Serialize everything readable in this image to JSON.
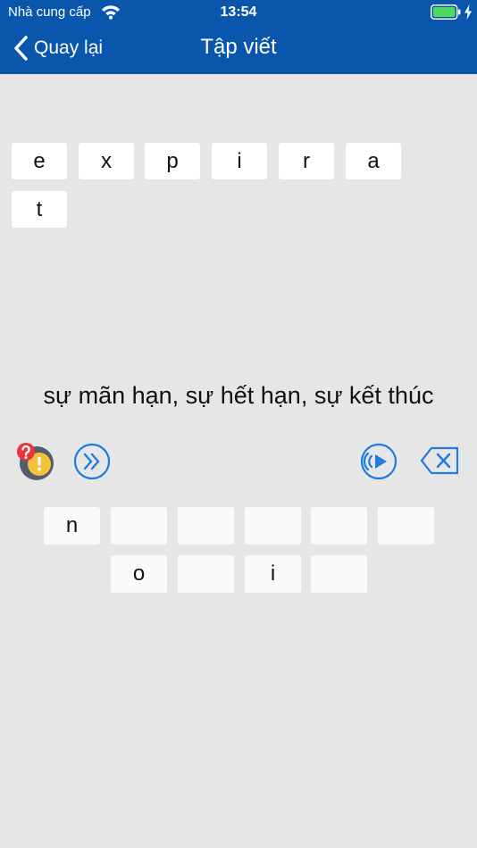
{
  "status_bar": {
    "carrier": "Nhà cung cấp",
    "time": "13:54"
  },
  "nav": {
    "back_label": "Quay lại",
    "title": "Tập viết"
  },
  "letter_choices": [
    "e",
    "x",
    "p",
    "i",
    "r",
    "a",
    "t"
  ],
  "meaning": "sự mãn hạn, sự hết hạn, sự kết thúc",
  "answer_slots": [
    "n",
    "",
    "",
    "",
    "",
    "",
    "o",
    "",
    "i",
    ""
  ],
  "icons": {
    "hint": "hint-question-icon",
    "skip": "skip-forward-icon",
    "speaker": "speaker-icon",
    "backspace": "backspace-icon"
  },
  "colors": {
    "nav_bar": "#0a56ad",
    "accent": "#1e7be0",
    "background": "#e6e6e6"
  }
}
